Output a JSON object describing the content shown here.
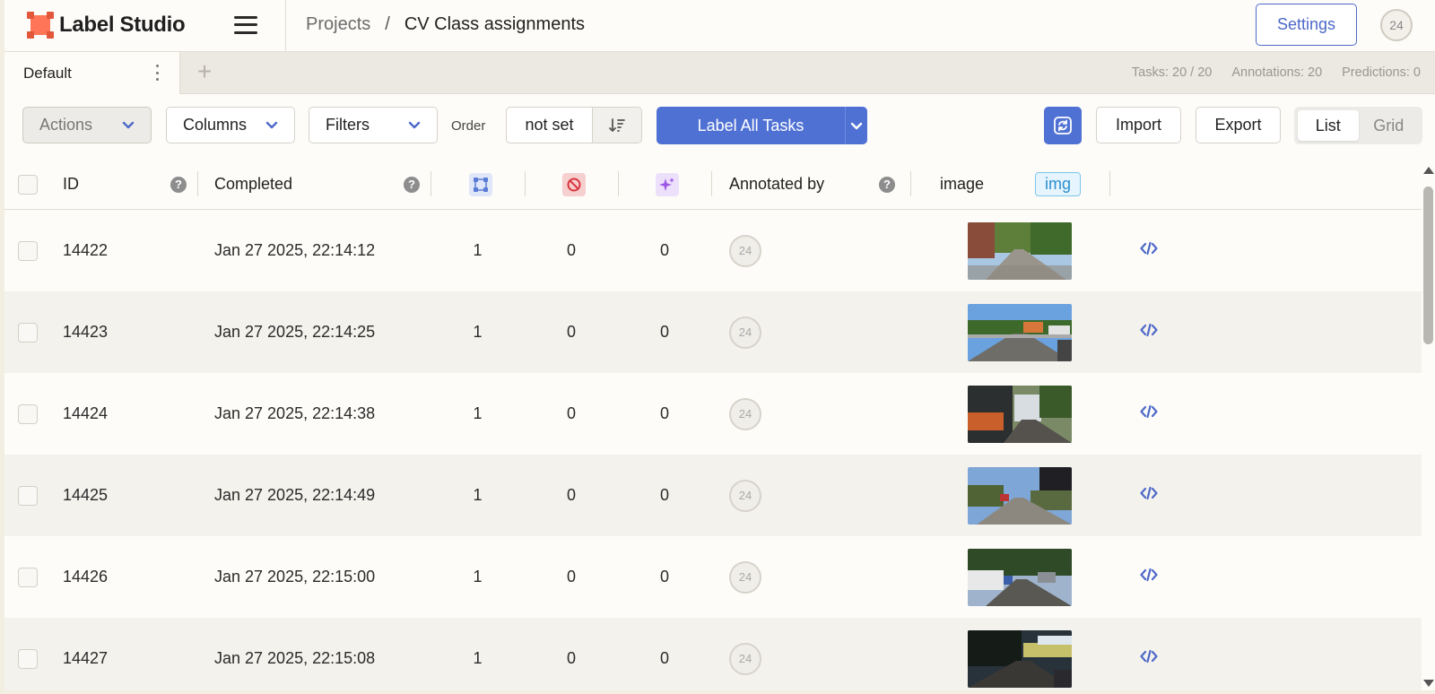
{
  "header": {
    "logo_text": "Label Studio",
    "breadcrumb": {
      "projects": "Projects",
      "separator": "/",
      "current": "CV Class assignments"
    },
    "settings_label": "Settings",
    "user_avatar": "24"
  },
  "tabs": {
    "active_tab": "Default",
    "add_symbol": "+",
    "stats": {
      "tasks": "Tasks: 20 / 20",
      "annotations": "Annotations: 20",
      "predictions": "Predictions: 0"
    }
  },
  "toolbar": {
    "actions": "Actions",
    "columns": "Columns",
    "filters": "Filters",
    "order_label": "Order",
    "order_value": "not set",
    "label_all": "Label All Tasks",
    "import": "Import",
    "export": "Export",
    "view_list": "List",
    "view_grid": "Grid",
    "active_view": "List"
  },
  "table": {
    "columns": {
      "id": "ID",
      "completed": "Completed",
      "annotated_by": "Annotated by",
      "image": "image",
      "image_tag": "img",
      "help": "?"
    },
    "icons": {
      "annotations": "annotations-count-icon",
      "cancelled": "cancelled-icon",
      "predictions": "predictions-sparkle-icon"
    },
    "rows": [
      {
        "id": "14422",
        "completed": "Jan 27 2025, 22:14:12",
        "annotations": "1",
        "cancelled": "0",
        "predictions": "0",
        "annotator": "24",
        "image_scene": "road-trees"
      },
      {
        "id": "14423",
        "completed": "Jan 27 2025, 22:14:25",
        "annotations": "1",
        "cancelled": "0",
        "predictions": "0",
        "annotator": "24",
        "image_scene": "highway-bus"
      },
      {
        "id": "14424",
        "completed": "Jan 27 2025, 22:14:38",
        "annotations": "1",
        "cancelled": "0",
        "predictions": "0",
        "annotator": "24",
        "image_scene": "trucks-dark"
      },
      {
        "id": "14425",
        "completed": "Jan 27 2025, 22:14:49",
        "annotations": "1",
        "cancelled": "0",
        "predictions": "0",
        "annotator": "24",
        "image_scene": "street-sky"
      },
      {
        "id": "14426",
        "completed": "Jan 27 2025, 22:15:00",
        "annotations": "1",
        "cancelled": "0",
        "predictions": "0",
        "annotator": "24",
        "image_scene": "street-vehicles"
      },
      {
        "id": "14427",
        "completed": "Jan 27 2025, 22:15:08",
        "annotations": "1",
        "cancelled": "0",
        "predictions": "0",
        "annotator": "24",
        "image_scene": "night-road"
      }
    ]
  },
  "colors": {
    "accent": "#5071d4",
    "logo": "#ff7557",
    "image_tag": "#2a8fd0"
  }
}
